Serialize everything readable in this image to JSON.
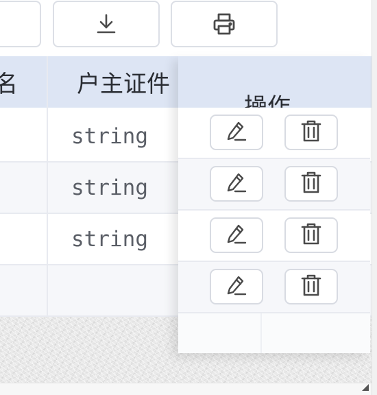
{
  "toolbar": {
    "buttons": [
      {
        "name": "left-button",
        "icon": "none"
      },
      {
        "name": "download-button",
        "icon": "download-icon"
      },
      {
        "name": "print-button",
        "icon": "printer-icon"
      }
    ]
  },
  "table": {
    "headers": [
      "名",
      "户主证件",
      "操作"
    ],
    "rows": [
      {
        "doc": "string"
      },
      {
        "doc": "string"
      },
      {
        "doc": "string"
      },
      {
        "doc": ""
      }
    ]
  },
  "colors": {
    "header_bg": "#dde5f4",
    "border": "#dcdfe6",
    "icon": "#4a4a4a",
    "cell_text": "#5a5e66"
  }
}
